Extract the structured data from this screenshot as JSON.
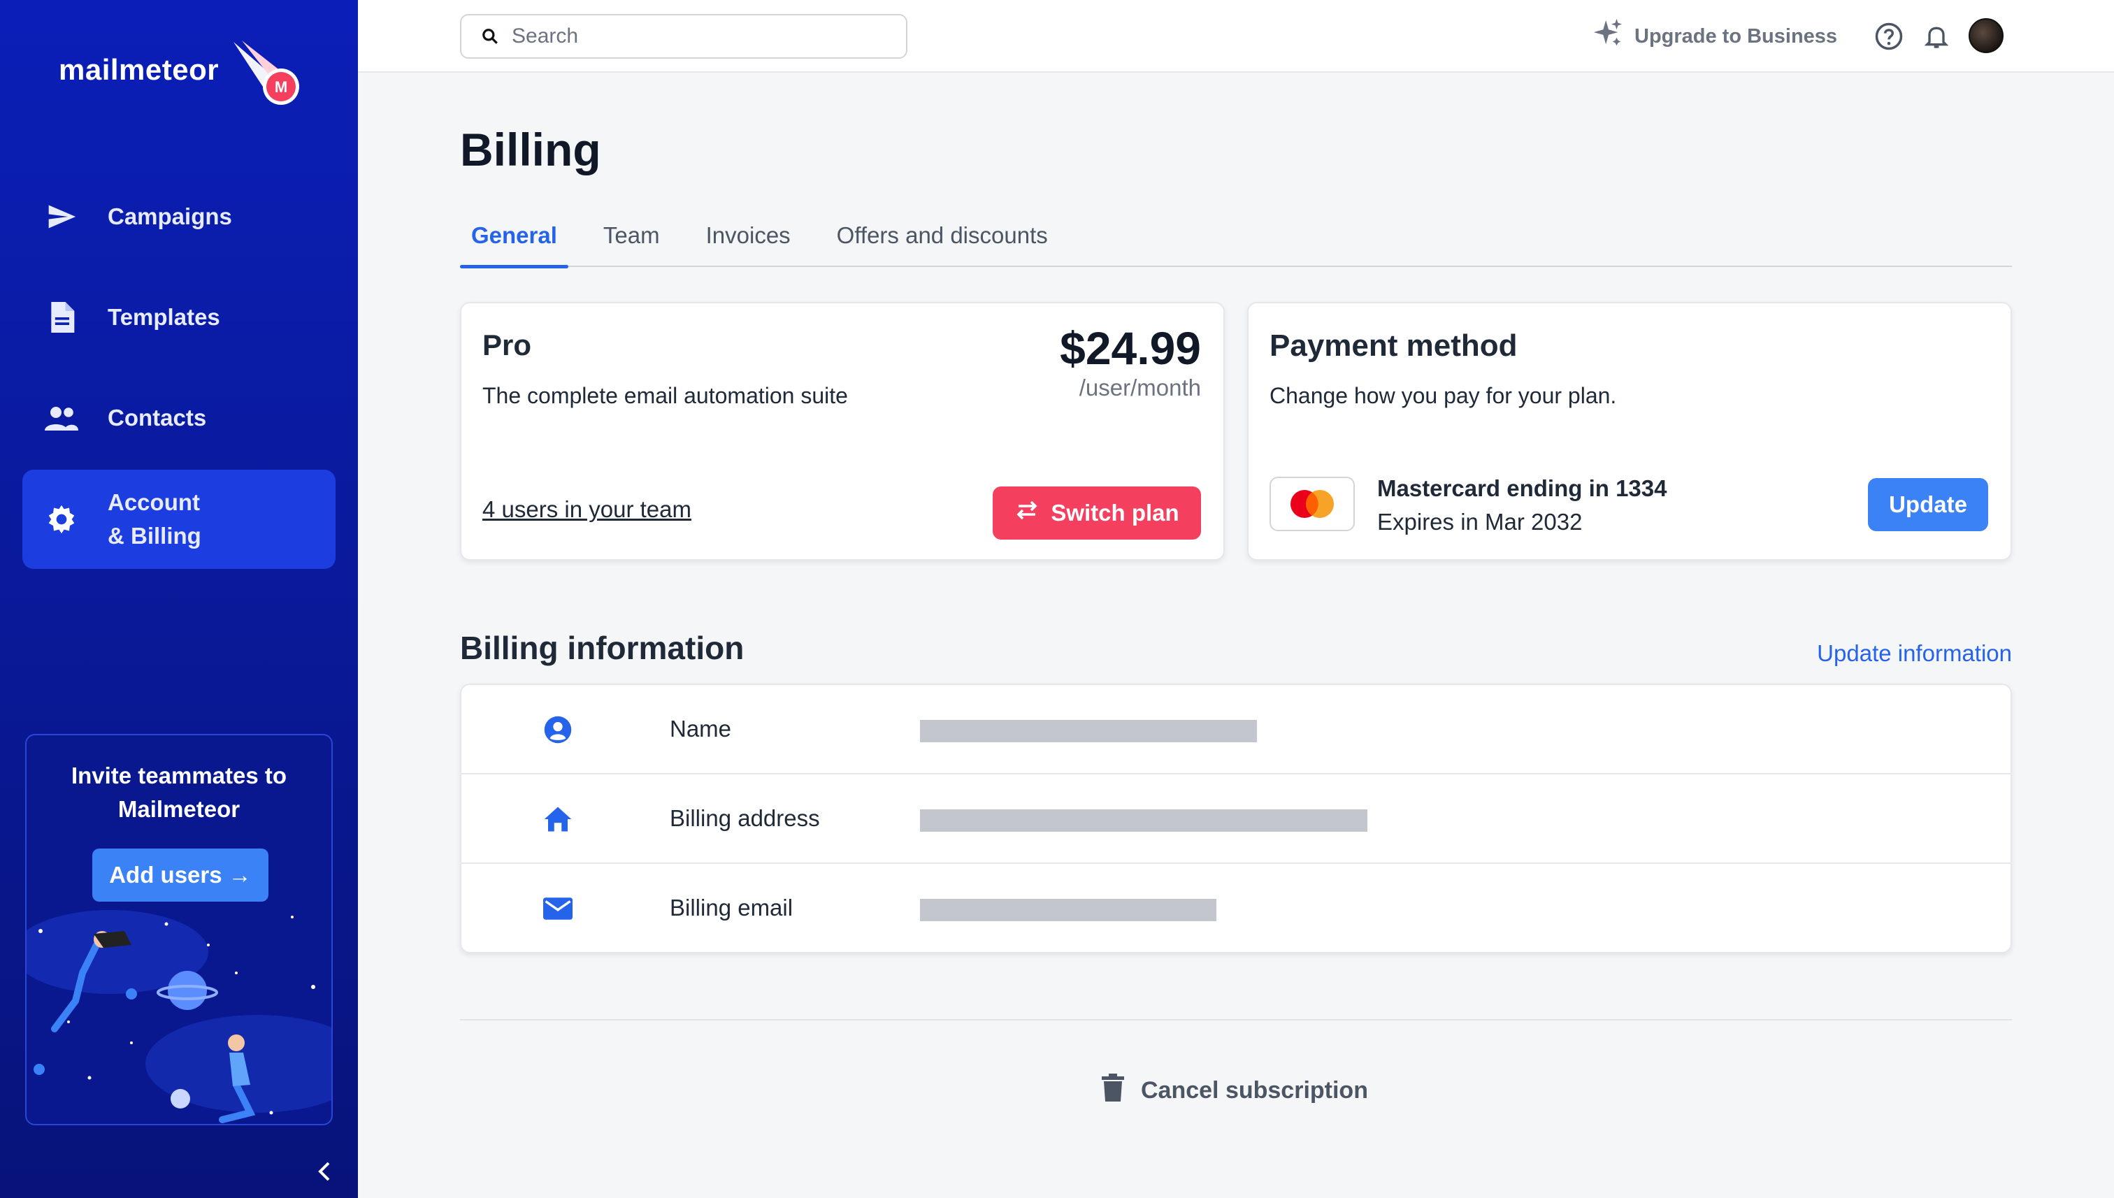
{
  "brand": {
    "name": "mailmeteor"
  },
  "sidebar": {
    "items": [
      {
        "label": "Campaigns",
        "icon": "paper-plane-icon"
      },
      {
        "label": "Templates",
        "icon": "document-icon"
      },
      {
        "label": "Contacts",
        "icon": "people-icon"
      },
      {
        "label_line1": "Account",
        "label_line2": "& Billing",
        "icon": "gear-icon",
        "active": true
      }
    ],
    "invite": {
      "title_line1": "Invite teammates to",
      "title_line2": "Mailmeteor",
      "button": "Add users →"
    }
  },
  "topbar": {
    "search_placeholder": "Search",
    "upgrade_label": "Upgrade to Business"
  },
  "page": {
    "title": "Billing"
  },
  "tabs": [
    {
      "label": "General",
      "active": true
    },
    {
      "label": "Team"
    },
    {
      "label": "Invoices"
    },
    {
      "label": "Offers and discounts"
    }
  ],
  "plan": {
    "name": "Pro",
    "description": "The complete email automation suite",
    "price": "$24.99",
    "period": "/user/month",
    "team_link": "4 users in your team",
    "switch_label": "Switch plan"
  },
  "payment": {
    "title": "Payment method",
    "description": "Change how you pay for your plan.",
    "card_name": "Mastercard ending in 1334",
    "card_expiry": "Expires in Mar 2032",
    "update_label": "Update"
  },
  "billing_info": {
    "title": "Billing information",
    "update_link": "Update information",
    "rows": [
      {
        "label": "Name",
        "icon": "user-circle-icon"
      },
      {
        "label": "Billing address",
        "icon": "home-icon"
      },
      {
        "label": "Billing email",
        "icon": "envelope-icon"
      }
    ]
  },
  "cancel": {
    "label": "Cancel subscription"
  },
  "colors": {
    "sidebar": "#0a1fb8",
    "primary": "#3b82f6",
    "link": "#2563eb",
    "danger": "#f43f5e"
  }
}
